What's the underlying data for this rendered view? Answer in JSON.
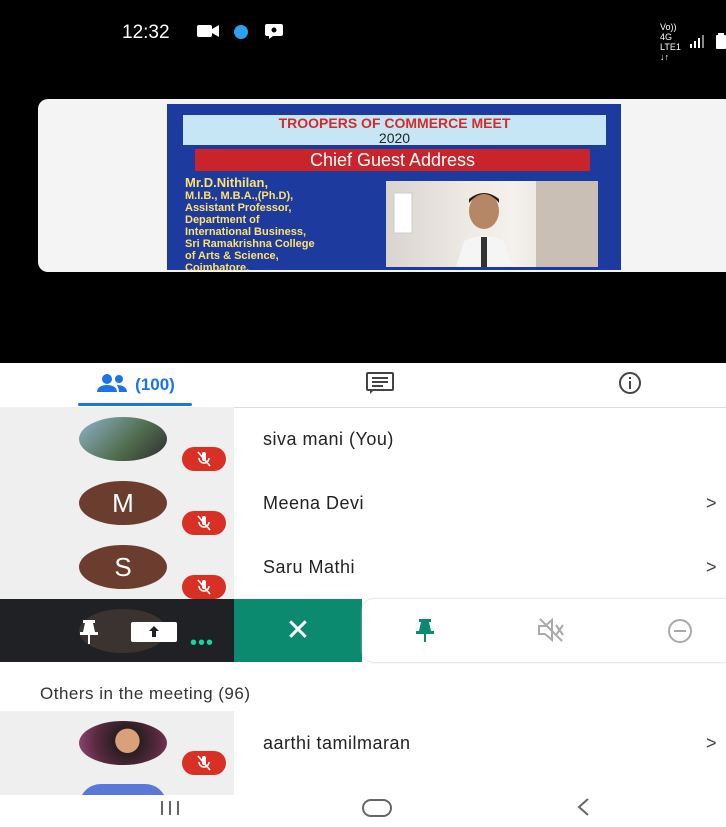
{
  "status_bar": {
    "time": "12:32",
    "right_label": "Vo)) 4G",
    "right_sub": "LTE1 ↓↑"
  },
  "slide": {
    "title": "TROOPERS OF COMMERCE MEET",
    "year": "2020",
    "subtitle": "Chief Guest Address",
    "speaker_name": "Mr.D.Nithilan,",
    "speaker_lines": [
      "M.I.B., M.B.A.,(Ph.D),",
      "Assistant Professor,",
      "Department of",
      "International Business,",
      "Sri Ramakrishna College",
      "of Arts & Science,",
      "Coimbatore."
    ]
  },
  "tabs": {
    "people_label": "(100)"
  },
  "participants": [
    {
      "name": "siva mani (You)",
      "initial": "",
      "color": "#6a8caa",
      "chevron": ""
    },
    {
      "name": "Meena Devi",
      "initial": "M",
      "color": "#6b3d2e",
      "chevron": ">"
    },
    {
      "name": "Saru Mathi",
      "initial": "S",
      "color": "#6b3d2e",
      "chevron": ">"
    }
  ],
  "action_bar": {
    "close_symbol": "✕",
    "dots": "•••"
  },
  "others": {
    "label": "Others in the meeting (96)",
    "first": {
      "name": "aarthi tamilmaran",
      "chevron": ">"
    }
  },
  "colors": {
    "accent": "#1a73e8",
    "mute_red": "#d93025",
    "teal": "#0b8a70"
  }
}
